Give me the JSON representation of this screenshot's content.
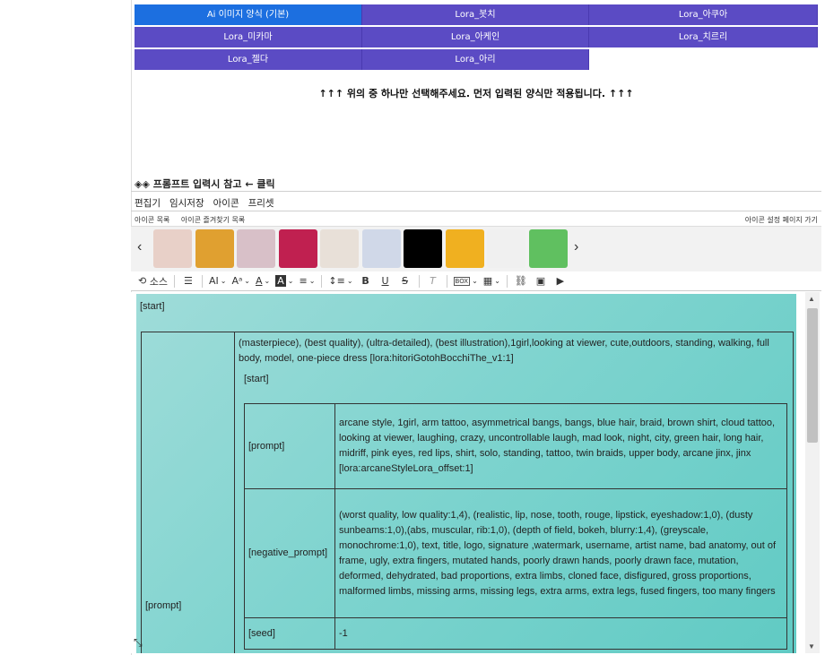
{
  "style_buttons": [
    {
      "label": "Ai 이미지 양식 (기본)",
      "active": true
    },
    {
      "label": "Lora_봇치",
      "active": false
    },
    {
      "label": "Lora_아쿠아",
      "active": false
    },
    {
      "label": "Lora_미카마",
      "active": false
    },
    {
      "label": "Lora_아케인",
      "active": false
    },
    {
      "label": "Lora_치르리",
      "active": false
    },
    {
      "label": "Lora_젤다",
      "active": false
    },
    {
      "label": "Lora_아리",
      "active": false
    }
  ],
  "notice": "↑↑↑ 위의 중 하나만 선택해주세요. 먼저 입력된 양식만 적용됩니다. ↑↑↑",
  "reference_link": "◈◈ 프롬프트 입력시 참고 ← 클릭",
  "menubar": [
    "편집기",
    "임시저장",
    "아이콘",
    "프리셋"
  ],
  "icon_bar": {
    "list": "아이콘 목록",
    "favorites": "아이콘 즐겨찾기 목록",
    "settings": "아이콘 설정 페이지 가기"
  },
  "carousel": {
    "prev": "‹",
    "next": "›",
    "thumbs": [
      {
        "icon": "icon-1",
        "color": "#e8d0c8"
      },
      {
        "icon": "icon-2",
        "color": "#e0a030"
      },
      {
        "icon": "icon-3",
        "color": "#d8c0c8"
      },
      {
        "icon": "icon-4",
        "color": "#c02050"
      },
      {
        "icon": "icon-5",
        "color": "#e8e0d8"
      },
      {
        "icon": "icon-6",
        "color": "#d0d8e8"
      },
      {
        "icon": "icon-7",
        "color": "#000000"
      },
      {
        "icon": "icon-8",
        "color": "#f0b020"
      },
      {
        "icon": "icon-9",
        "color": "#f0f0f0"
      },
      {
        "icon": "icon-10",
        "color": "#60c060"
      }
    ]
  },
  "toolbar": {
    "source": "소스",
    "box": "BOX"
  },
  "editor": {
    "start_top": "[start]",
    "outer_label": "[prompt]",
    "main_prompt": "(masterpiece), (best quality), (ultra-detailed), (best illustration),1girl,looking at viewer, cute,outdoors, standing, walking, full body, model, one-piece dress [lora:hitoriGotohBocchiThe_v1:1]",
    "inner_start": "[start]",
    "rows": [
      {
        "key": "[prompt]",
        "value": "arcane style, 1girl, arm tattoo, asymmetrical bangs, bangs, blue hair, braid, brown shirt, cloud tattoo, looking at viewer, laughing, crazy, uncontrollable laugh, mad look, night, city, green hair, long hair, midriff, pink eyes, red lips, shirt, solo, standing, tattoo, twin braids, upper body, arcane jinx, jinx [lora:arcaneStyleLora_offset:1]"
      },
      {
        "key": "[negative_prompt]",
        "value": "(worst quality, low quality:1,4), (realistic, lip, nose, tooth, rouge, lipstick, eyeshadow:1,0), (dusty sunbeams:1,0),(abs, muscular, rib:1,0), (depth of field, bokeh, blurry:1,4), (greyscale, monochrome:1,0), text, title, logo, signature ,watermark, username, artist name, bad anatomy, out of frame, ugly, extra fingers, mutated hands, poorly drawn hands, poorly drawn face, mutation, deformed, dehydrated, bad proportions, extra limbs, cloned face, disfigured, gross proportions, malformed limbs, missing arms, missing legs, extra arms, extra legs, fused fingers, too many fingers"
      },
      {
        "key": "[seed]",
        "value": "-1"
      }
    ]
  }
}
